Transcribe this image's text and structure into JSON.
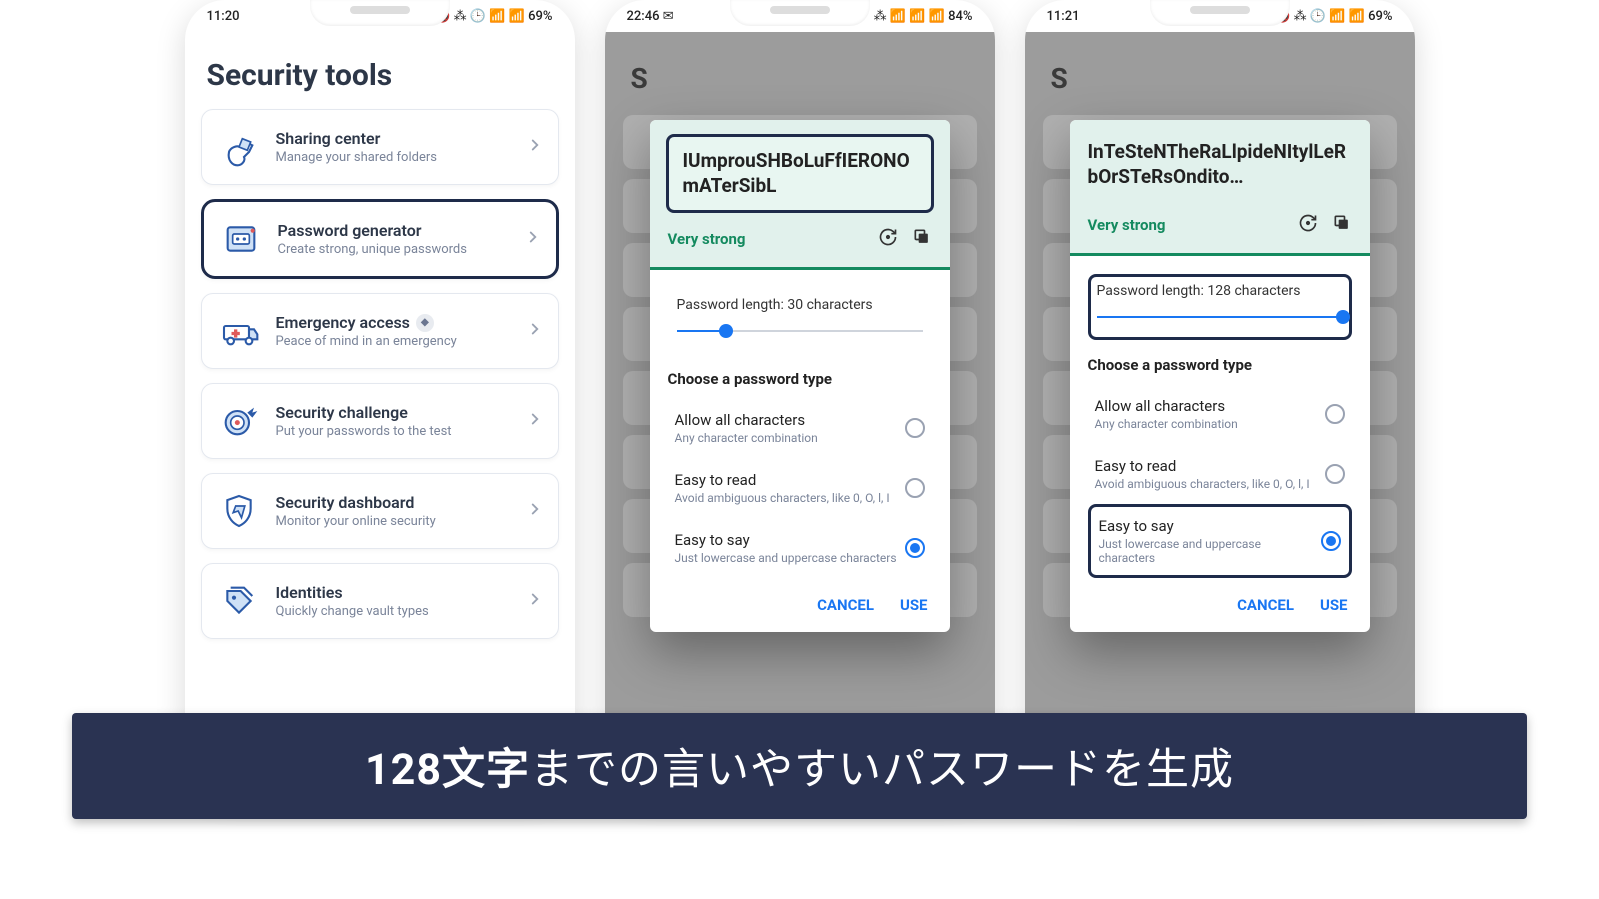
{
  "caption_bold": "128文字",
  "caption_rest": "までの言いやすいパスワードを生成",
  "phone1": {
    "status": {
      "time": "11:20",
      "right": "🔇 ⁂ 🕒 📶 📶 69%"
    },
    "title": "Security tools",
    "items": [
      {
        "title": "Sharing center",
        "sub": "Manage your shared folders",
        "icon": "share"
      },
      {
        "title": "Password generator",
        "sub": "Create strong, unique passwords",
        "icon": "pwgen",
        "highlight": true
      },
      {
        "title": "Emergency access",
        "sub": "Peace of mind in an emergency",
        "icon": "ambulance",
        "badge": true
      },
      {
        "title": "Security challenge",
        "sub": "Put your passwords to the test",
        "icon": "target"
      },
      {
        "title": "Security dashboard",
        "sub": "Monitor your online security",
        "icon": "shield"
      },
      {
        "title": "Identities",
        "sub": "Quickly change vault types",
        "icon": "tags"
      }
    ]
  },
  "phone2": {
    "status": {
      "time": "22:46 ✉",
      "right": "⁂ 📶 📶 📶 84%"
    },
    "behind": "S",
    "password": "IUmprouSHBoLuFfIERONOmATerSibL",
    "strength": "Very strong",
    "length_label": "Password length: 30 characters",
    "slider_pct": 20,
    "section": "Choose a password type",
    "options": [
      {
        "t": "Allow all characters",
        "s": "Any character combination",
        "sel": false
      },
      {
        "t": "Easy to read",
        "s": "Avoid ambiguous characters, like 0, O, l, I",
        "sel": false
      },
      {
        "t": "Easy to say",
        "s": "Just lowercase and uppercase characters",
        "sel": true
      }
    ],
    "cancel": "CANCEL",
    "use": "USE"
  },
  "phone3": {
    "status": {
      "time": "11:21",
      "right": "🔇 ⁂ 🕒 📶 📶 69%"
    },
    "behind": "S",
    "password": "InTeSteNTheRaLlpideNItylLeRbOrSTeRsOndito…",
    "strength": "Very strong",
    "length_label": "Password length: 128 characters",
    "slider_pct": 100,
    "section": "Choose a password type",
    "options": [
      {
        "t": "Allow all characters",
        "s": "Any character combination",
        "sel": false
      },
      {
        "t": "Easy to read",
        "s": "Avoid ambiguous characters, like 0, O, l, I",
        "sel": false
      },
      {
        "t": "Easy to say",
        "s": "Just lowercase and uppercase characters",
        "sel": true,
        "highlight": true
      }
    ],
    "cancel": "CANCEL",
    "use": "USE"
  }
}
